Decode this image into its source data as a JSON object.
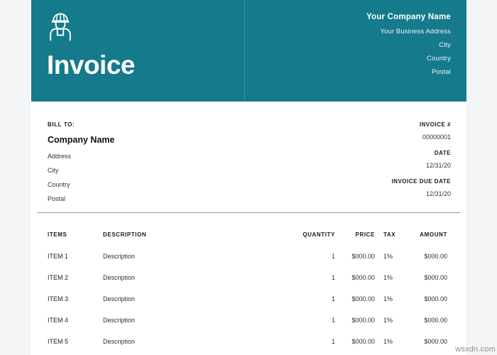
{
  "document": {
    "title": "Invoice",
    "watermark": "wsxdn.com",
    "accent_color": "#157a8c",
    "page_background": "#ffffff",
    "canvas_background": "#f4f5f7"
  },
  "header": {
    "logo_icon": "construction-worker-icon",
    "title": "Invoice",
    "company": {
      "name": "Your Company Name",
      "lines": [
        "Your Business Address",
        "City",
        "Country",
        "Postal"
      ]
    }
  },
  "bill_to": {
    "label": "BILL TO:",
    "company_name": "Company Name",
    "lines": [
      "Address",
      "City",
      "Country",
      "Postal"
    ]
  },
  "invoice_info": [
    {
      "label": "INVOICE #",
      "value": "00000001"
    },
    {
      "label": "DATE",
      "value": "12/31/20"
    },
    {
      "label": "INVOICE DUE DATE",
      "value": "12/31/20"
    }
  ],
  "items_table": {
    "columns": {
      "items": "ITEMS",
      "description": "DESCRIPTION",
      "quantity": "QUANTITY",
      "price": "PRICE",
      "tax": "TAX",
      "amount": "AMOUNT"
    },
    "rows": [
      {
        "item": "ITEM 1",
        "description": "Description",
        "quantity": "1",
        "price": "$000.00",
        "tax": "1%",
        "amount": "$000.00"
      },
      {
        "item": "ITEM 2",
        "description": "Description",
        "quantity": "1",
        "price": "$000.00",
        "tax": "1%",
        "amount": "$000.00"
      },
      {
        "item": "ITEM 3",
        "description": "Description",
        "quantity": "1",
        "price": "$000.00",
        "tax": "1%",
        "amount": "$000.00"
      },
      {
        "item": "ITEM 4",
        "description": "Description",
        "quantity": "1",
        "price": "$000.00",
        "tax": "1%",
        "amount": "$000.00"
      },
      {
        "item": "ITEM 5",
        "description": "Description",
        "quantity": "1",
        "price": "$000.00",
        "tax": "1%",
        "amount": "$000.00"
      }
    ]
  }
}
